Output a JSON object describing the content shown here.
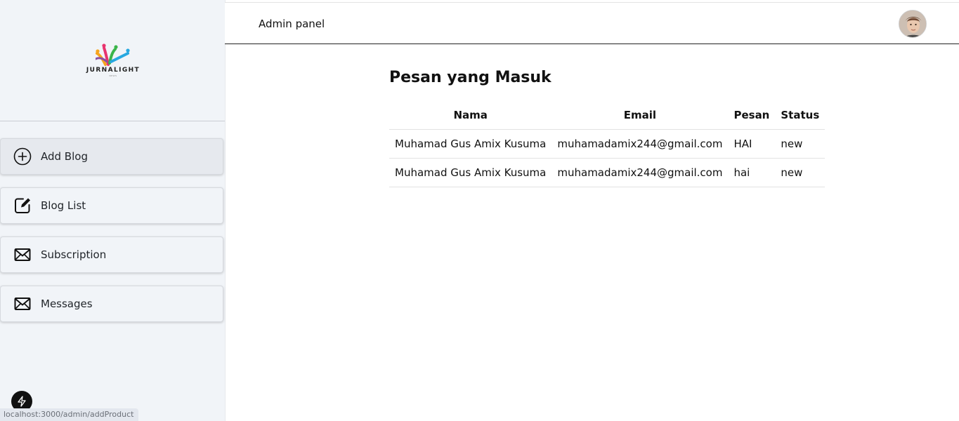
{
  "brand": {
    "name": "JURNALIGHT",
    "tagline": "NEWS"
  },
  "sidebar": {
    "items": [
      {
        "label": "Add Blog",
        "icon": "plus-circle-icon"
      },
      {
        "label": "Blog List",
        "icon": "edit-icon"
      },
      {
        "label": "Subscription",
        "icon": "mail-icon"
      },
      {
        "label": "Messages",
        "icon": "mail-icon"
      }
    ]
  },
  "header": {
    "title": "Admin panel",
    "avatar": "user-avatar"
  },
  "main": {
    "title": "Pesan yang Masuk",
    "columns": [
      "Nama",
      "Email",
      "Pesan",
      "Status"
    ],
    "rows": [
      [
        "Muhamad Gus Amix Kusuma",
        "muhamadamix244@gmail.com",
        "HAI",
        "new"
      ],
      [
        "Muhamad Gus Amix Kusuma",
        "muhamadamix244@gmail.com",
        "hai",
        "new"
      ]
    ]
  },
  "status_bar": {
    "url": "localhost:3000/admin/addProduct"
  },
  "colors": {
    "sidebar_bg": "#f1f4f8",
    "active_item_bg": "#e6e9ee",
    "text": "#111111"
  }
}
